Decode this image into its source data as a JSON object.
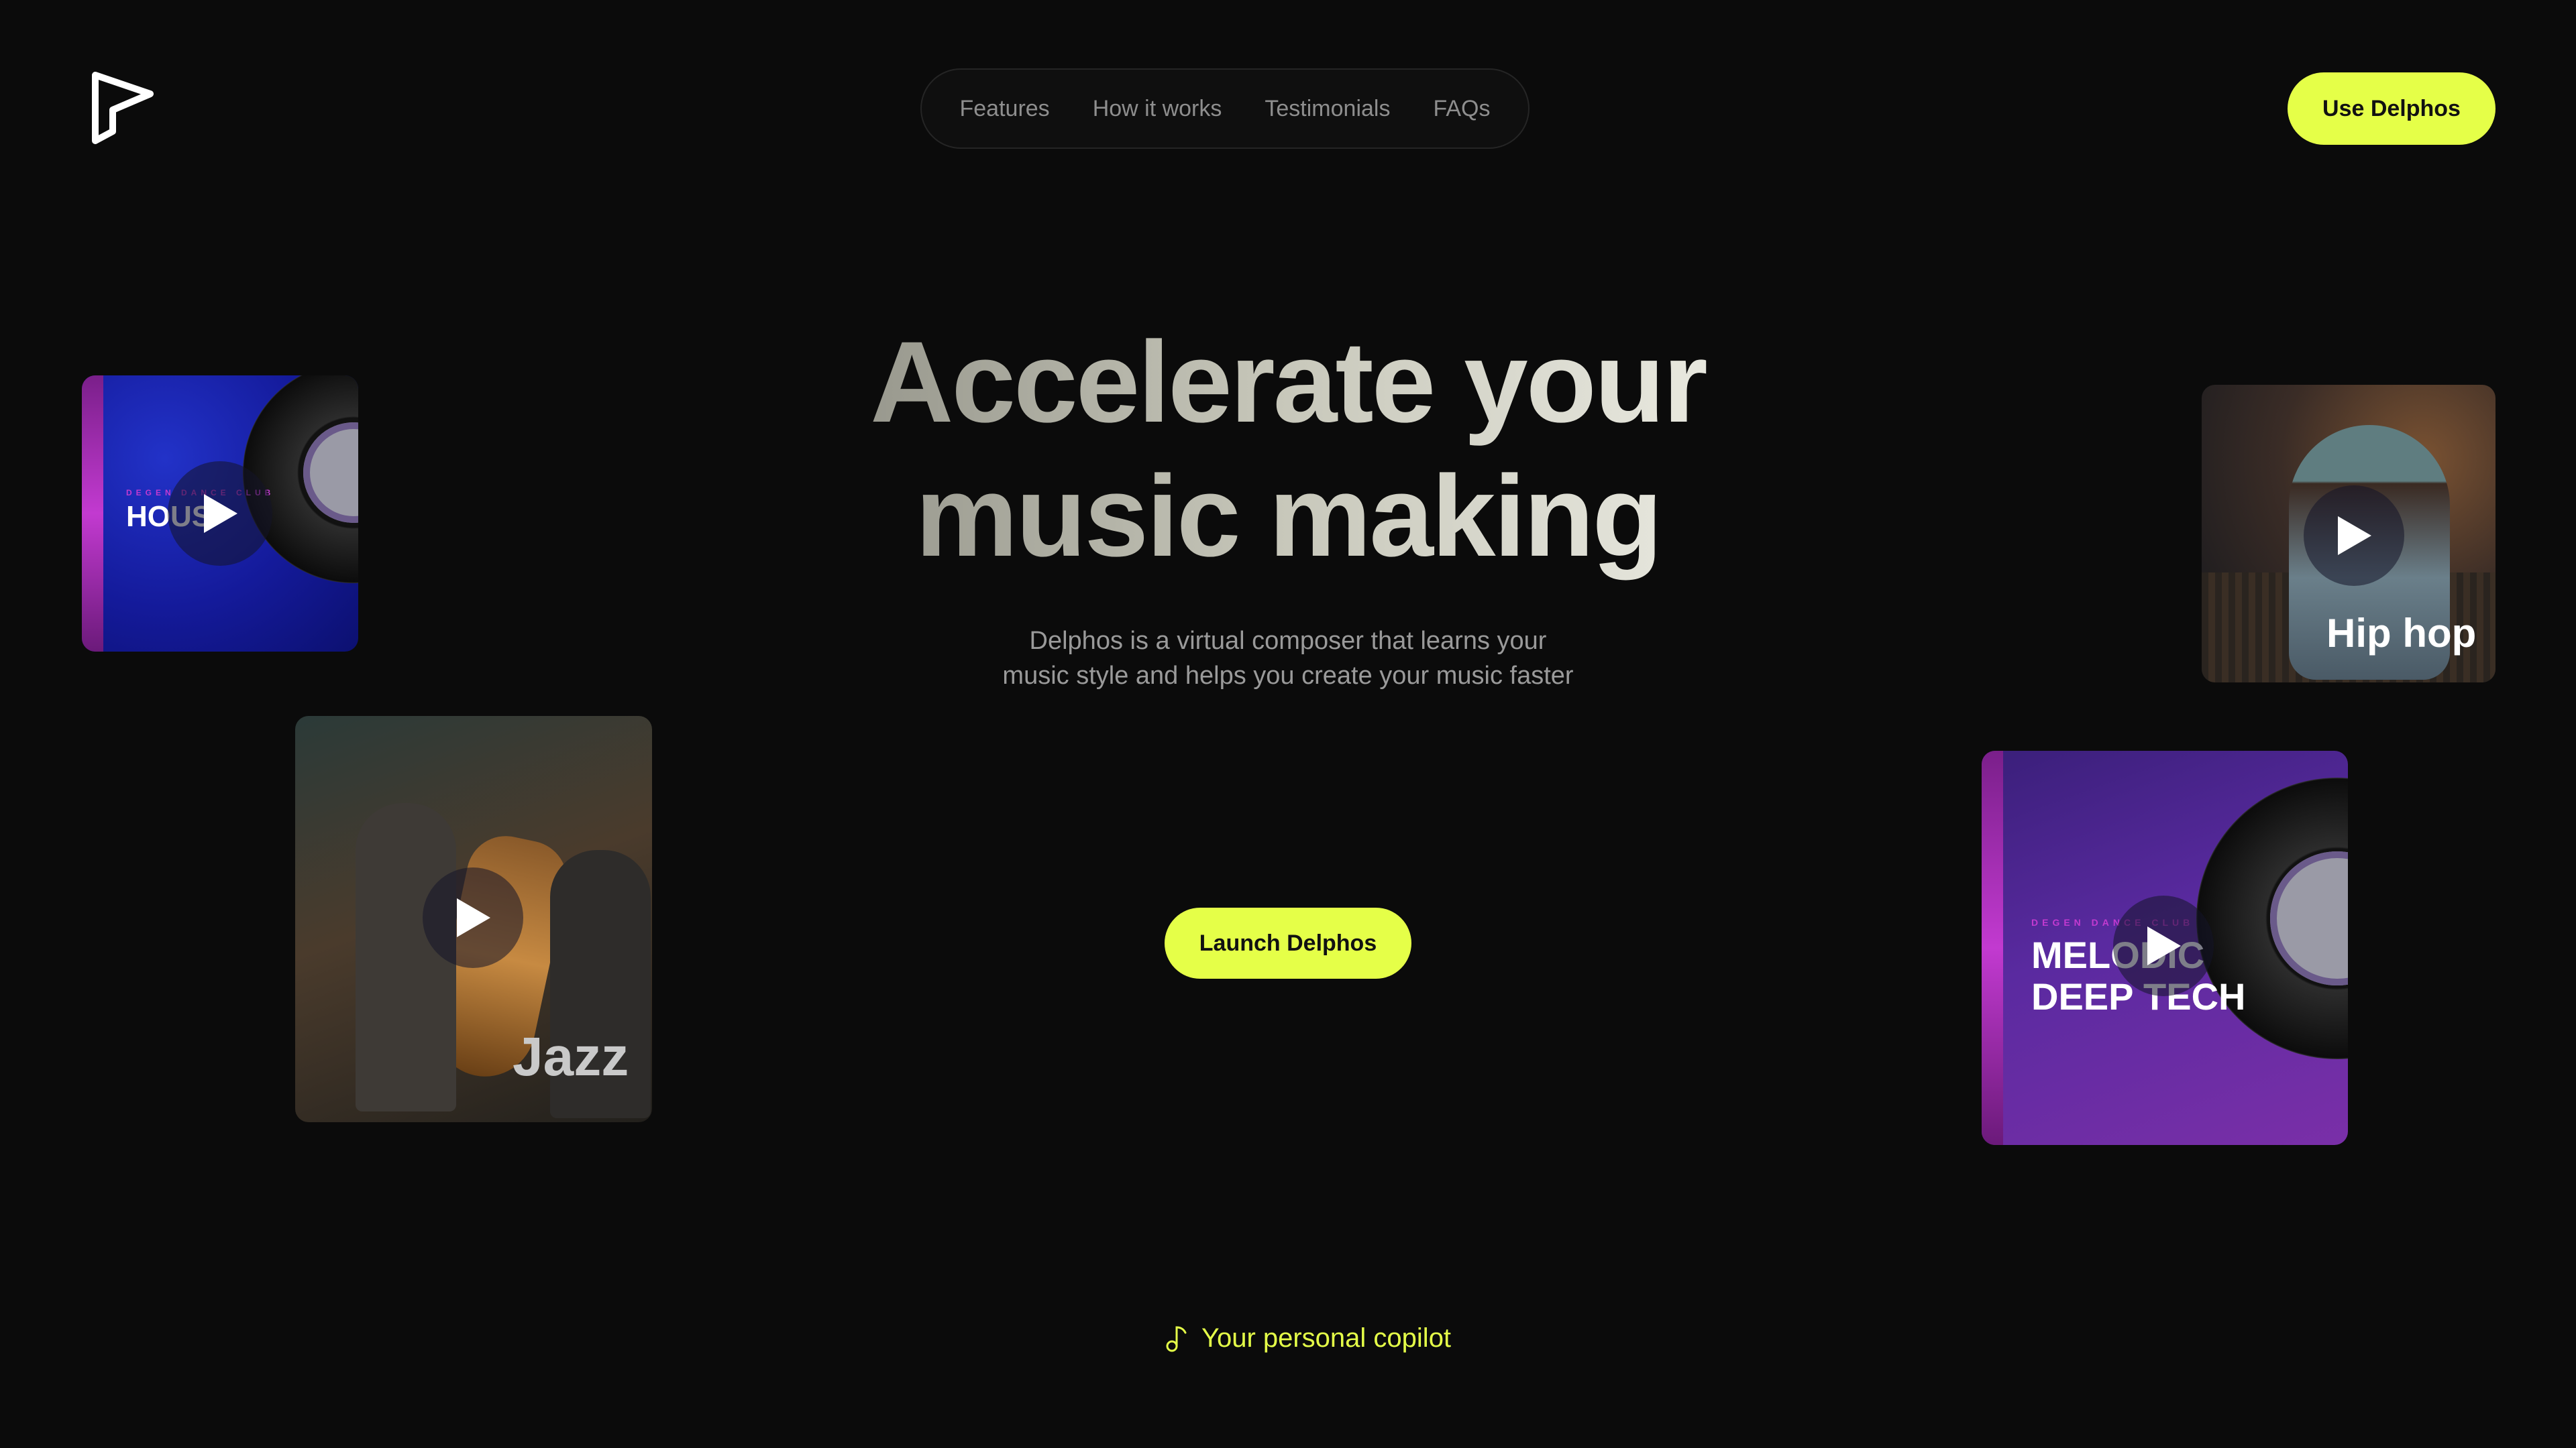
{
  "header": {
    "logo_icon": "play-triangle-logo",
    "nav": [
      {
        "label": "Features"
      },
      {
        "label": "How it works"
      },
      {
        "label": "Testimonials"
      },
      {
        "label": "FAQs"
      }
    ],
    "cta_label": "Use Delphos"
  },
  "hero": {
    "title_line1": "Accelerate your",
    "title_line2": "music making",
    "subtitle_line1": "Delphos is a virtual composer that learns your",
    "subtitle_line2": "music style and helps you create your music faster",
    "cta_label": "Launch Delphos"
  },
  "footer_hint": {
    "icon": "music-note-icon",
    "label": "Your personal copilot"
  },
  "cards": {
    "house": {
      "genre": "HOUS",
      "club": "DEGEN DANCE CLUB",
      "icon": "play-icon"
    },
    "jazz": {
      "genre": "Jazz",
      "icon": "play-icon"
    },
    "hiphop": {
      "genre": "Hip hop",
      "icon": "play-icon"
    },
    "melodic": {
      "genre_line1": "MELODIC",
      "genre_line2": "DEEP TECH",
      "club": "DEGEN DANCE CLUB",
      "icon": "play-icon"
    }
  },
  "colors": {
    "background": "#0b0b0b",
    "accent": "#e5ff48",
    "muted_text": "#9a9a9a"
  }
}
